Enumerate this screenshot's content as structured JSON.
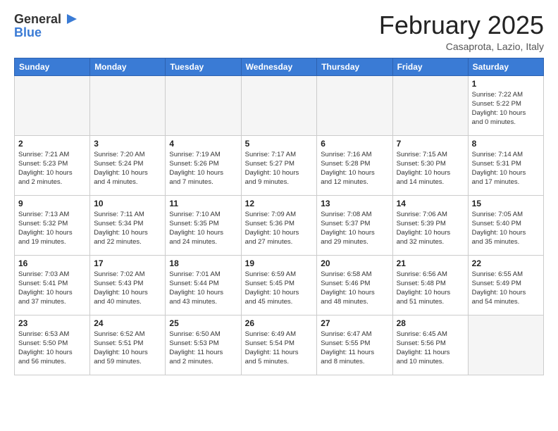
{
  "header": {
    "logo_line1": "General",
    "logo_line2": "Blue",
    "month_title": "February 2025",
    "location": "Casaprota, Lazio, Italy"
  },
  "weekdays": [
    "Sunday",
    "Monday",
    "Tuesday",
    "Wednesday",
    "Thursday",
    "Friday",
    "Saturday"
  ],
  "weeks": [
    [
      {
        "day": "",
        "info": ""
      },
      {
        "day": "",
        "info": ""
      },
      {
        "day": "",
        "info": ""
      },
      {
        "day": "",
        "info": ""
      },
      {
        "day": "",
        "info": ""
      },
      {
        "day": "",
        "info": ""
      },
      {
        "day": "1",
        "info": "Sunrise: 7:22 AM\nSunset: 5:22 PM\nDaylight: 10 hours\nand 0 minutes."
      }
    ],
    [
      {
        "day": "2",
        "info": "Sunrise: 7:21 AM\nSunset: 5:23 PM\nDaylight: 10 hours\nand 2 minutes."
      },
      {
        "day": "3",
        "info": "Sunrise: 7:20 AM\nSunset: 5:24 PM\nDaylight: 10 hours\nand 4 minutes."
      },
      {
        "day": "4",
        "info": "Sunrise: 7:19 AM\nSunset: 5:26 PM\nDaylight: 10 hours\nand 7 minutes."
      },
      {
        "day": "5",
        "info": "Sunrise: 7:17 AM\nSunset: 5:27 PM\nDaylight: 10 hours\nand 9 minutes."
      },
      {
        "day": "6",
        "info": "Sunrise: 7:16 AM\nSunset: 5:28 PM\nDaylight: 10 hours\nand 12 minutes."
      },
      {
        "day": "7",
        "info": "Sunrise: 7:15 AM\nSunset: 5:30 PM\nDaylight: 10 hours\nand 14 minutes."
      },
      {
        "day": "8",
        "info": "Sunrise: 7:14 AM\nSunset: 5:31 PM\nDaylight: 10 hours\nand 17 minutes."
      }
    ],
    [
      {
        "day": "9",
        "info": "Sunrise: 7:13 AM\nSunset: 5:32 PM\nDaylight: 10 hours\nand 19 minutes."
      },
      {
        "day": "10",
        "info": "Sunrise: 7:11 AM\nSunset: 5:34 PM\nDaylight: 10 hours\nand 22 minutes."
      },
      {
        "day": "11",
        "info": "Sunrise: 7:10 AM\nSunset: 5:35 PM\nDaylight: 10 hours\nand 24 minutes."
      },
      {
        "day": "12",
        "info": "Sunrise: 7:09 AM\nSunset: 5:36 PM\nDaylight: 10 hours\nand 27 minutes."
      },
      {
        "day": "13",
        "info": "Sunrise: 7:08 AM\nSunset: 5:37 PM\nDaylight: 10 hours\nand 29 minutes."
      },
      {
        "day": "14",
        "info": "Sunrise: 7:06 AM\nSunset: 5:39 PM\nDaylight: 10 hours\nand 32 minutes."
      },
      {
        "day": "15",
        "info": "Sunrise: 7:05 AM\nSunset: 5:40 PM\nDaylight: 10 hours\nand 35 minutes."
      }
    ],
    [
      {
        "day": "16",
        "info": "Sunrise: 7:03 AM\nSunset: 5:41 PM\nDaylight: 10 hours\nand 37 minutes."
      },
      {
        "day": "17",
        "info": "Sunrise: 7:02 AM\nSunset: 5:43 PM\nDaylight: 10 hours\nand 40 minutes."
      },
      {
        "day": "18",
        "info": "Sunrise: 7:01 AM\nSunset: 5:44 PM\nDaylight: 10 hours\nand 43 minutes."
      },
      {
        "day": "19",
        "info": "Sunrise: 6:59 AM\nSunset: 5:45 PM\nDaylight: 10 hours\nand 45 minutes."
      },
      {
        "day": "20",
        "info": "Sunrise: 6:58 AM\nSunset: 5:46 PM\nDaylight: 10 hours\nand 48 minutes."
      },
      {
        "day": "21",
        "info": "Sunrise: 6:56 AM\nSunset: 5:48 PM\nDaylight: 10 hours\nand 51 minutes."
      },
      {
        "day": "22",
        "info": "Sunrise: 6:55 AM\nSunset: 5:49 PM\nDaylight: 10 hours\nand 54 minutes."
      }
    ],
    [
      {
        "day": "23",
        "info": "Sunrise: 6:53 AM\nSunset: 5:50 PM\nDaylight: 10 hours\nand 56 minutes."
      },
      {
        "day": "24",
        "info": "Sunrise: 6:52 AM\nSunset: 5:51 PM\nDaylight: 10 hours\nand 59 minutes."
      },
      {
        "day": "25",
        "info": "Sunrise: 6:50 AM\nSunset: 5:53 PM\nDaylight: 11 hours\nand 2 minutes."
      },
      {
        "day": "26",
        "info": "Sunrise: 6:49 AM\nSunset: 5:54 PM\nDaylight: 11 hours\nand 5 minutes."
      },
      {
        "day": "27",
        "info": "Sunrise: 6:47 AM\nSunset: 5:55 PM\nDaylight: 11 hours\nand 8 minutes."
      },
      {
        "day": "28",
        "info": "Sunrise: 6:45 AM\nSunset: 5:56 PM\nDaylight: 11 hours\nand 10 minutes."
      },
      {
        "day": "",
        "info": ""
      }
    ]
  ]
}
